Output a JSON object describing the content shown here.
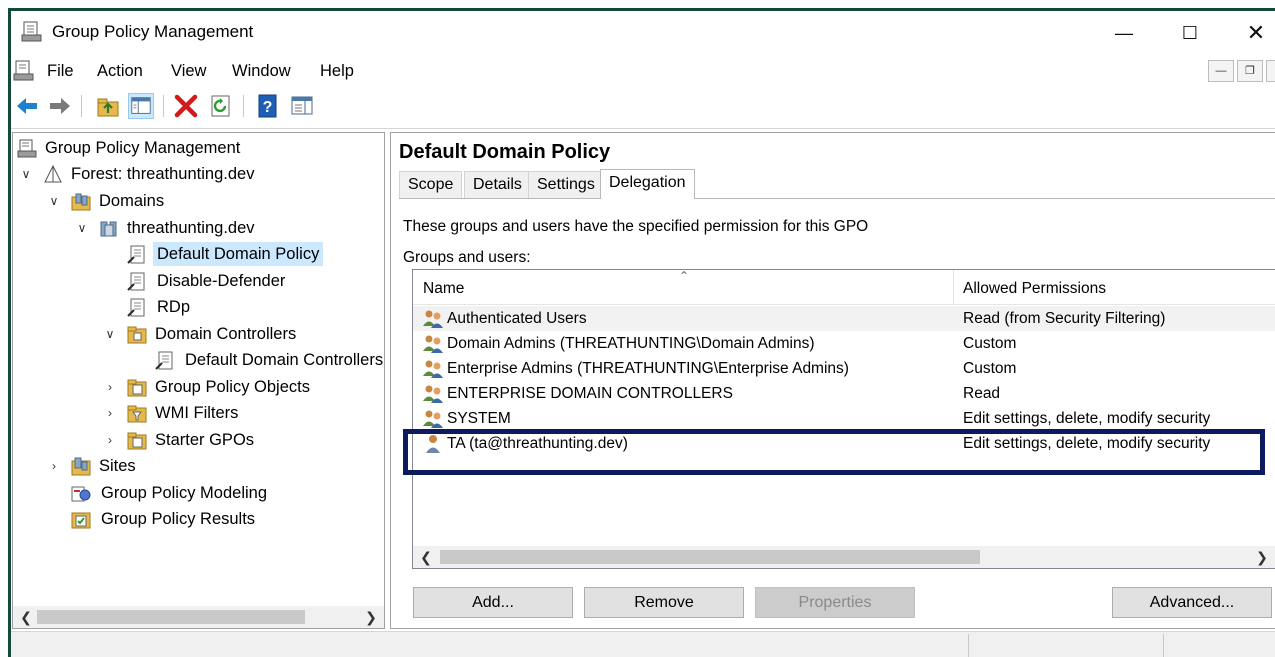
{
  "window": {
    "title": "Group Policy Management"
  },
  "menu": [
    "File",
    "Action",
    "View",
    "Window",
    "Help"
  ],
  "toolbar": [
    "back-icon",
    "forward-icon",
    "up-folder-icon",
    "show-hide-tree-icon",
    "delete-icon",
    "refresh-icon",
    "help-icon",
    "properties-view-icon"
  ],
  "tree": {
    "root": "Group Policy Management",
    "forest": "Forest: threathunting.dev",
    "domains": "Domains",
    "domain": "threathunting.dev",
    "gpo_default": "Default Domain Policy",
    "gpo_disable": "Disable-Defender",
    "gpo_rdp": "RDp",
    "ou_dc": "Domain Controllers",
    "gpo_ddc": "Default Domain Controllers Policy",
    "gpo_objects": "Group Policy Objects",
    "wmi": "WMI Filters",
    "starter": "Starter GPOs",
    "sites": "Sites",
    "modeling": "Group Policy Modeling",
    "results": "Group Policy Results"
  },
  "details": {
    "title": "Default Domain Policy",
    "tabs": [
      "Scope",
      "Details",
      "Settings",
      "Delegation"
    ],
    "active_tab": "Delegation",
    "description": "These groups and users have the specified permission for this GPO",
    "groups_label": "Groups and users:",
    "columns": {
      "name": "Name",
      "permissions": "Allowed Permissions"
    },
    "rows": [
      {
        "name": "Authenticated Users",
        "permission": "Read (from Security Filtering)",
        "icon": "group-icon"
      },
      {
        "name": "Domain Admins (THREATHUNTING\\Domain Admins)",
        "permission": "Custom",
        "icon": "group-icon"
      },
      {
        "name": "Enterprise Admins (THREATHUNTING\\Enterprise Admins)",
        "permission": "Custom",
        "icon": "group-icon"
      },
      {
        "name": "ENTERPRISE DOMAIN CONTROLLERS",
        "permission": "Read",
        "icon": "group-icon"
      },
      {
        "name": "SYSTEM",
        "permission": "Edit settings, delete, modify security",
        "icon": "group-icon"
      },
      {
        "name": "TA (ta@threathunting.dev)",
        "permission": "Edit settings, delete, modify security",
        "icon": "user-icon"
      }
    ],
    "buttons": {
      "add": "Add...",
      "remove": "Remove",
      "properties": "Properties",
      "advanced": "Advanced..."
    }
  },
  "colors": {
    "highlight_box": "#0d1b5e",
    "selection": "#cce8ff",
    "window_border": "#0f4a3c"
  }
}
